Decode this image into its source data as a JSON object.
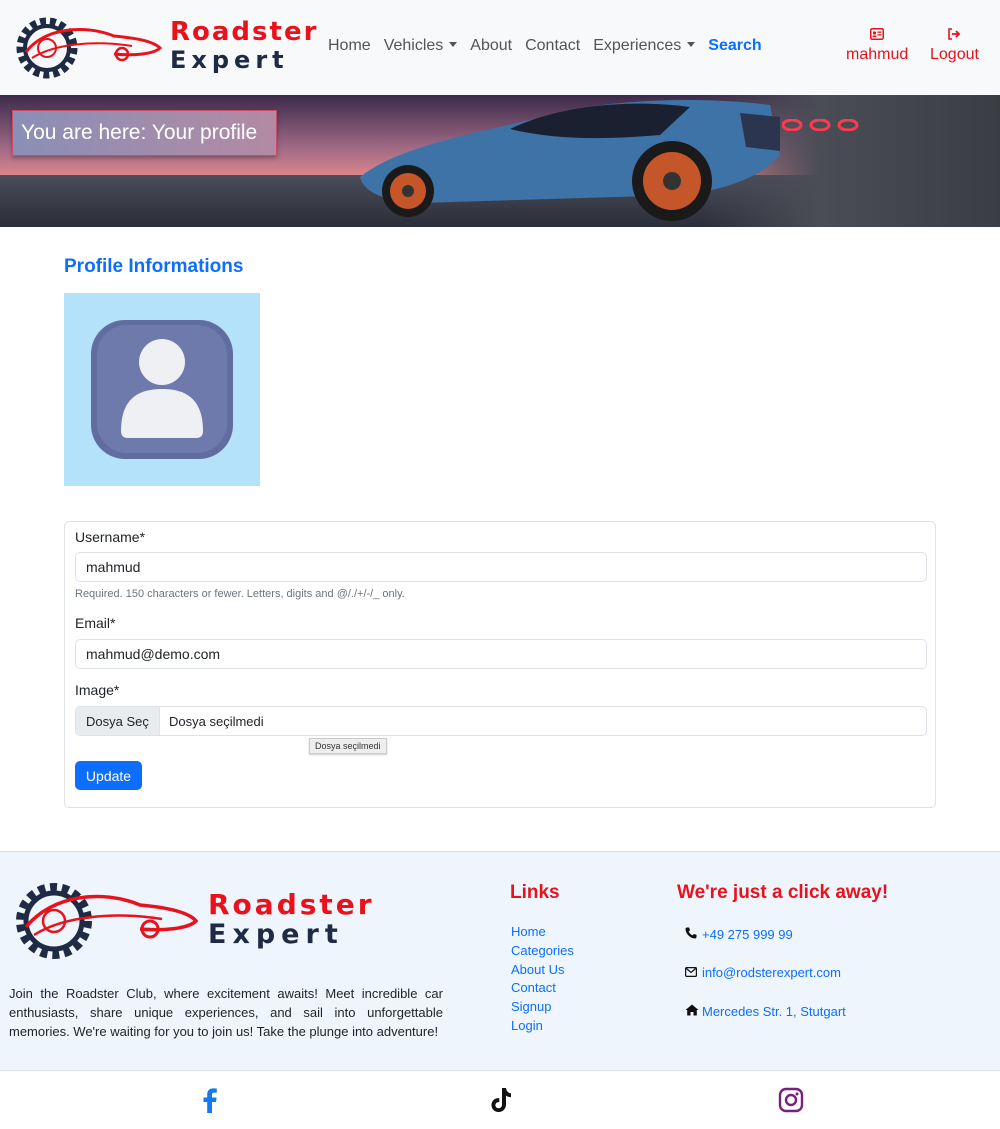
{
  "brand": {
    "line1": "Roadster",
    "line2": "Expert"
  },
  "nav": {
    "items": [
      {
        "label": "Home"
      },
      {
        "label": "Vehicles",
        "dropdown": true
      },
      {
        "label": "About"
      },
      {
        "label": "Contact"
      },
      {
        "label": "Experiences",
        "dropdown": true
      },
      {
        "label": "Search",
        "active": true
      }
    ],
    "user_label": "mahmud",
    "logout_label": "Logout"
  },
  "banner": {
    "breadcrumb": "You are here: Your profile"
  },
  "profile": {
    "title": "Profile Informations",
    "form": {
      "username_label": "Username*",
      "username_value": "mahmud",
      "username_help": "Required. 150 characters or fewer. Letters, digits and @/./+/-/_ only.",
      "email_label": "Email*",
      "email_value": "mahmud@demo.com",
      "image_label": "Image*",
      "file_button": "Dosya Seç",
      "file_status": "Dosya seçilmedi",
      "file_tooltip": "Dosya seçilmedi",
      "submit_label": "Update"
    }
  },
  "footer": {
    "about": "Join the Roadster Club, where excitement awaits! Meet incredible car enthusiasts, share unique experiences, and sail into unforgettable memories. We're waiting for you to join us! Take the plunge into adventure!",
    "links_title": "Links",
    "links": [
      "Home",
      "Categories",
      "About Us",
      "Contact",
      "Signup",
      "Login"
    ],
    "contact_title": "We're just a click away!",
    "phone": "+49 275 999 99",
    "email": "info@rodsterexpert.com",
    "address": "Mercedes Str. 1, Stutgart"
  },
  "socials": [
    {
      "name": "facebook-icon",
      "color": "#1877f2"
    },
    {
      "name": "tiktok-icon",
      "color": "#111111"
    },
    {
      "name": "instagram-icon",
      "color": "#7a1f7f"
    }
  ],
  "colors": {
    "brand_red": "#e8121d",
    "primary": "#0d6efd",
    "navy": "#1f2a44"
  }
}
